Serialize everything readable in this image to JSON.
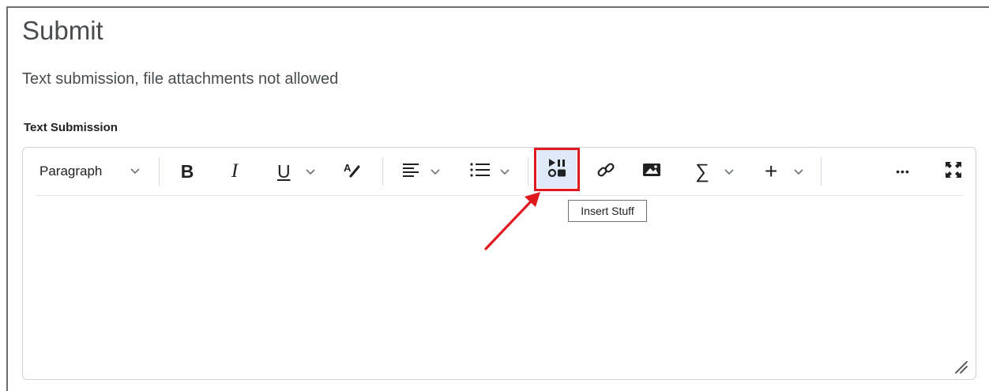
{
  "page": {
    "title": "Submit",
    "subtitle": "Text submission, file attachments not allowed",
    "field_label": "Text Submission"
  },
  "toolbar": {
    "paragraph_label": "Paragraph",
    "tooltip": "Insert Stuff",
    "icons": [
      "chevron-down-icon",
      "bold-icon",
      "italic-icon",
      "underline-icon",
      "text-color-icon",
      "align-icon",
      "list-icon",
      "insert-stuff-icon",
      "link-icon",
      "image-icon",
      "equation-icon",
      "plus-icon",
      "more-icon",
      "fullscreen-icon"
    ],
    "bold_glyph": "B",
    "italic_glyph": "I",
    "underline_glyph": "U",
    "equation_glyph": "∑",
    "plus_glyph": "+",
    "more_glyph": "•••"
  },
  "colors": {
    "highlight": "#e0191f",
    "text": "#494c4e",
    "border": "#cdd5dc"
  }
}
